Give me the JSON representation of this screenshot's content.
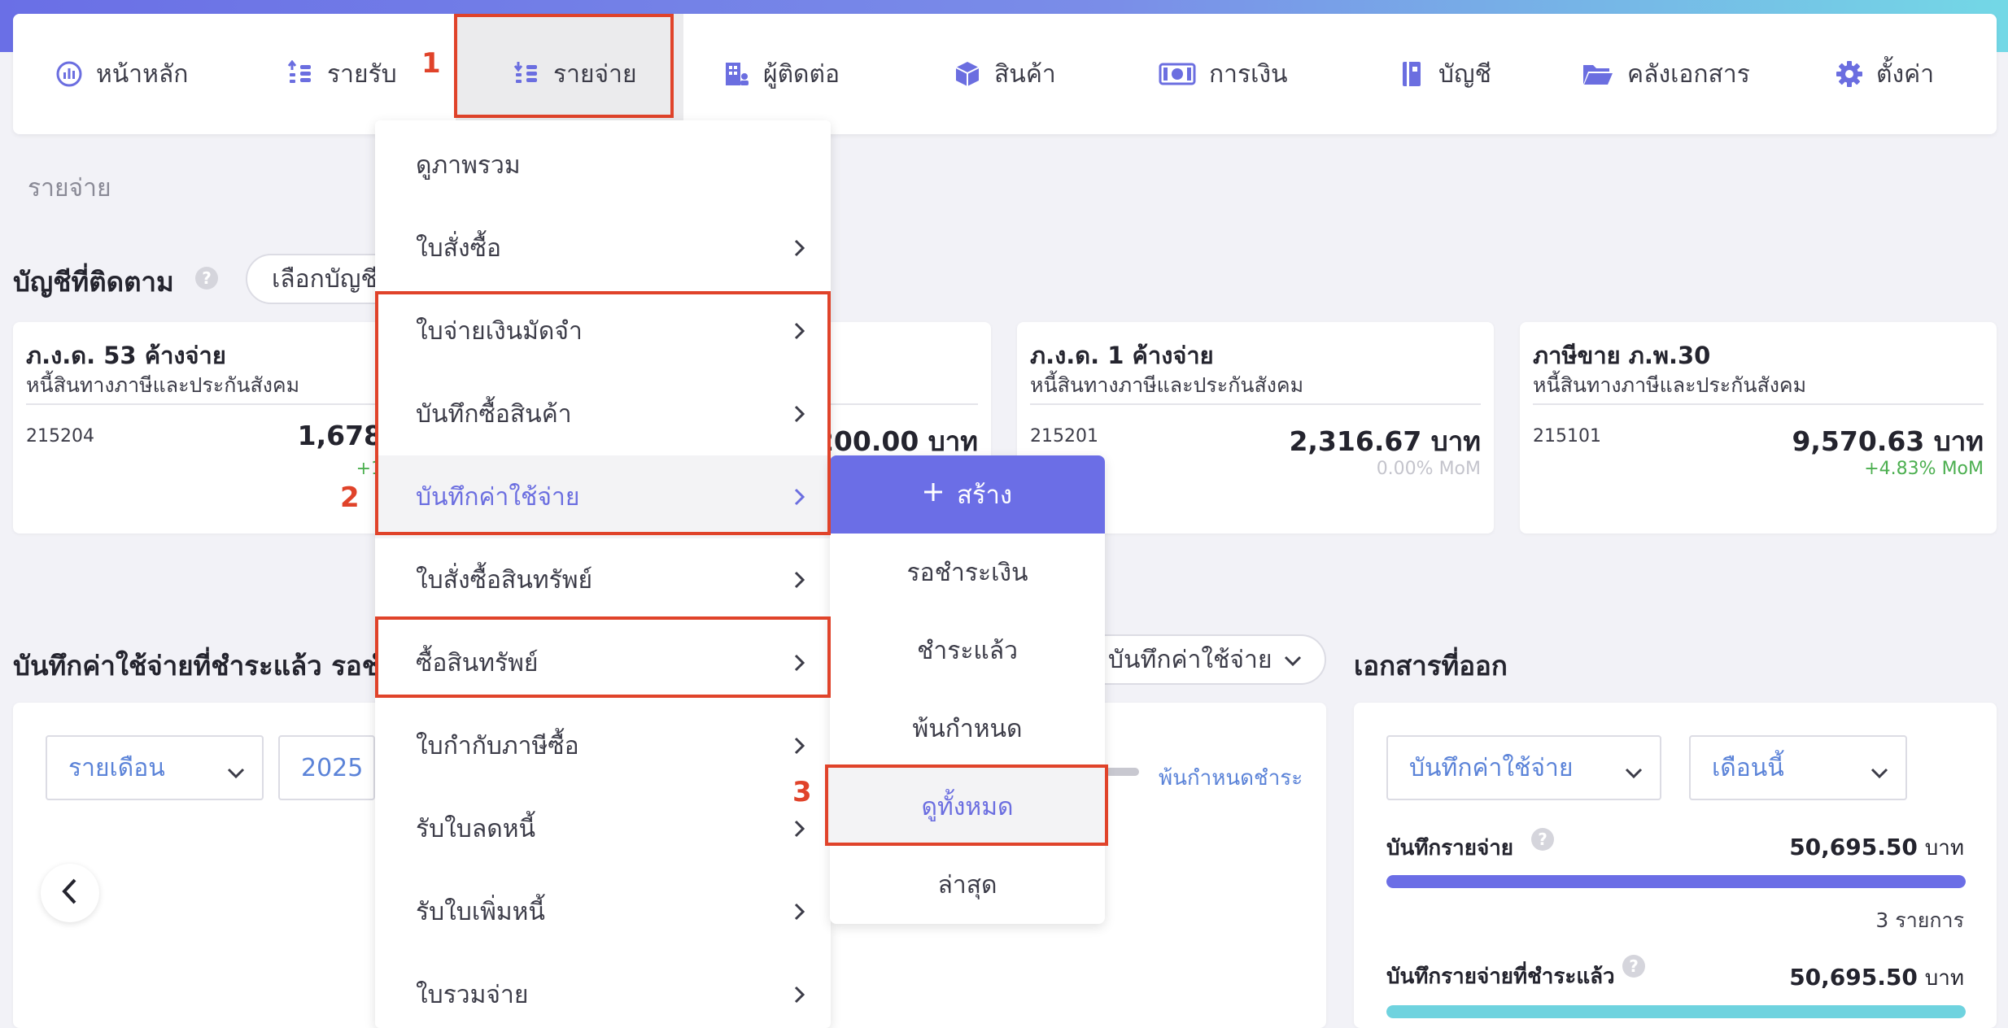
{
  "nav": {
    "items": [
      {
        "label": "หน้าหลัก",
        "icon": "chart-pie-icon"
      },
      {
        "label": "รายรับ",
        "icon": "coins-up-icon"
      },
      {
        "label": "รายจ่าย",
        "icon": "coins-down-icon"
      },
      {
        "label": "ผู้ติดต่อ",
        "icon": "building-icon"
      },
      {
        "label": "สินค้า",
        "icon": "box-icon"
      },
      {
        "label": "การเงิน",
        "icon": "money-bill-icon"
      },
      {
        "label": "บัญชี",
        "icon": "book-icon"
      },
      {
        "label": "คลังเอกสาร",
        "icon": "folder-icon"
      },
      {
        "label": "ตั้งค่า",
        "icon": "gear-icon"
      }
    ],
    "active_index": 2
  },
  "steps": {
    "one": "1",
    "two": "2",
    "three": "3"
  },
  "breadcrumb": "รายจ่าย",
  "tracked": {
    "title": "บัญชีที่ติดตาม",
    "select_label": "เลือกบัญชี",
    "cards": [
      {
        "name": "ภ.ง.ด. 53 ค้างจ่าย",
        "category": "หนี้สินทางภาษีและประกันสังคม",
        "code": "215204",
        "amount": "1,678",
        "mom": "+1"
      },
      {
        "amount": "200.00 บาท"
      },
      {
        "name": "ภ.ง.ด. 1 ค้างจ่าย",
        "category": "หนี้สินทางภาษีและประกันสังคม",
        "code": "215201",
        "amount": "2,316.67 บาท",
        "mom": "0.00% MoM"
      },
      {
        "name": "ภาษีขาย ภ.พ.30",
        "category": "หนี้สินทางภาษีและประกันสังคม",
        "code": "215101",
        "amount": "9,570.63 บาท",
        "mom": "+4.83% MoM"
      }
    ]
  },
  "expenses_section": {
    "title": "บันทึกค่าใช้จ่ายที่ชำระแล้ว รอชำ",
    "period_select": "รายเดือน",
    "year_select": "2025",
    "filter_pill": "บันทึกค่าใช้จ่าย",
    "legend_overdue": "พ้นกำหนดชำระ"
  },
  "issued_docs": {
    "title": "เอกสารที่ออก",
    "doc_type_select": "บันทึกค่าใช้จ่าย",
    "period_select": "เดือนนี้",
    "rows": [
      {
        "label": "บันทึกรายจ่าย",
        "amount": "50,695.50",
        "unit": "บาท",
        "count": "3 รายการ",
        "fill": 1.0
      },
      {
        "label": "บันทึกรายจ่ายที่ชำระแล้ว",
        "amount": "50,695.50",
        "unit": "บาท",
        "fill": 1.0
      }
    ]
  },
  "dropdown": {
    "items": [
      {
        "label": "ดูภาพรวม",
        "has_arrow": false
      },
      {
        "label": "ใบสั่งซื้อ",
        "has_arrow": true
      },
      {
        "label": "ใบจ่ายเงินมัดจำ",
        "has_arrow": true
      },
      {
        "label": "บันทึกซื้อสินค้า",
        "has_arrow": true
      },
      {
        "label": "บันทึกค่าใช้จ่าย",
        "has_arrow": true
      },
      {
        "label": "ใบสั่งซื้อสินทรัพย์",
        "has_arrow": true
      },
      {
        "label": "ซื้อสินทรัพย์",
        "has_arrow": true
      },
      {
        "label": "ใบกำกับภาษีซื้อ",
        "has_arrow": true
      },
      {
        "label": "รับใบลดหนี้",
        "has_arrow": true
      },
      {
        "label": "รับใบเพิ่มหนี้",
        "has_arrow": true
      },
      {
        "label": "ใบรวมจ่าย",
        "has_arrow": true
      }
    ],
    "hover_index": 4
  },
  "submenu": {
    "create_label": "สร้าง",
    "items": [
      "รอชำระเงิน",
      "ชำระแล้ว",
      "พ้นกำหนด",
      "ดูทั้งหมด",
      "ล่าสุด"
    ],
    "active_index": 3
  },
  "colors": {
    "accent": "#6b6ee6",
    "highlight": "#e0432a",
    "positive": "#4caf50",
    "teal": "#6fd3df"
  }
}
